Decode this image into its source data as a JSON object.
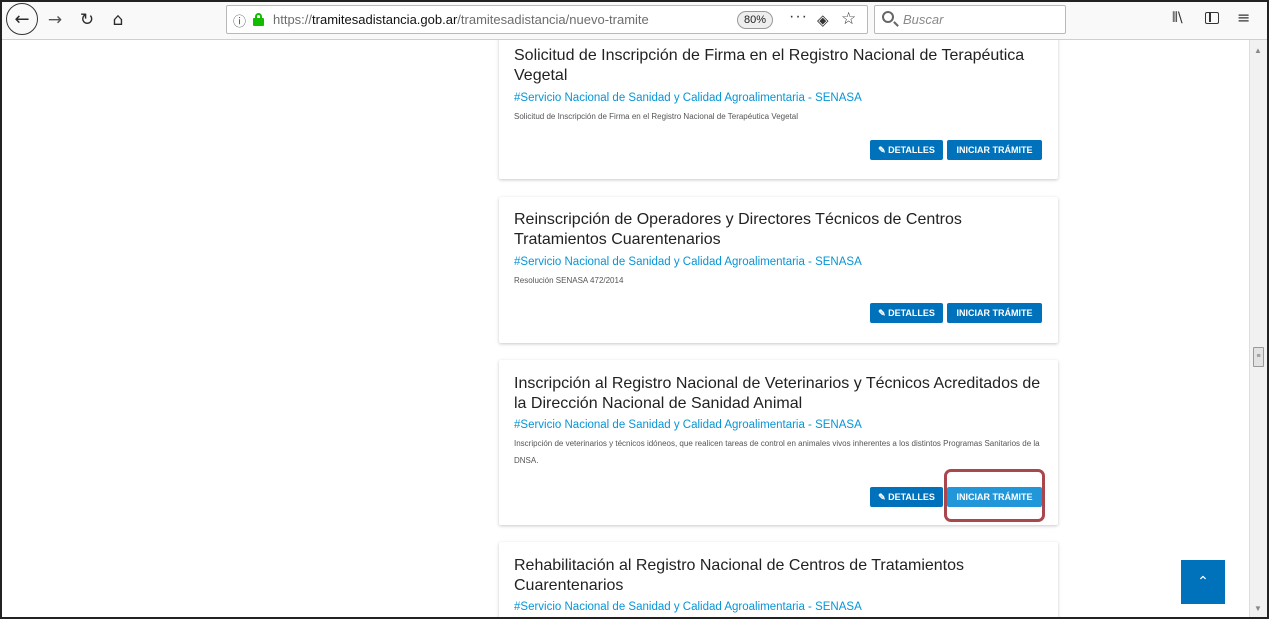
{
  "browser": {
    "url_prefix": "https://",
    "url_domain": "tramitesadistancia.gob.ar",
    "url_path": "/tramitesadistancia/nuevo-tramite",
    "zoom": "80%",
    "search_placeholder": "Buscar",
    "icons": [
      "back-arrow-icon",
      "forward-arrow-icon",
      "reload-icon",
      "home-icon",
      "info-icon",
      "lock-icon",
      "page-actions-icon",
      "pocket-icon",
      "bookmark-star-icon",
      "search-icon",
      "library-icon",
      "sidebar-icon",
      "hamburger-menu-icon"
    ]
  },
  "cards": [
    {
      "title": "Solicitud de Inscripción de Firma en el Registro Nacional de Terapéutica Vegetal",
      "org": "#Servicio Nacional de Sanidad y Calidad Agroalimentaria - SENASA",
      "desc": "Solicitud de Inscripción de Firma en el Registro Nacional de Terapéutica Vegetal",
      "details_label": "✎ DETALLES",
      "start_label": "INICIAR TRÁMITE"
    },
    {
      "title": "Reinscripción de Operadores y Directores Técnicos de Centros Tratamientos Cuarentenarios",
      "org": "#Servicio Nacional de Sanidad y Calidad Agroalimentaria - SENASA",
      "desc": "Resolución SENASA 472/2014",
      "details_label": "✎ DETALLES",
      "start_label": "INICIAR TRÁMITE"
    },
    {
      "title": "Inscripción al Registro Nacional de Veterinarios y Técnicos Acreditados de la Dirección Nacional de Sanidad Animal",
      "org": "#Servicio Nacional de Sanidad y Calidad Agroalimentaria - SENASA",
      "desc": "Inscripción de veterinarios y técnicos idóneos, que realicen tareas de control en animales vivos inherentes a los distintos Programas Sanitarios de la DNSA.",
      "details_label": "✎ DETALLES",
      "start_label": "INICIAR TRÁMITE"
    },
    {
      "title": "Rehabilitación al Registro Nacional de Centros de Tratamientos Cuarentenarios",
      "org": "#Servicio Nacional de Sanidad y Calidad Agroalimentaria - SENASA"
    }
  ],
  "back_to_top_label": "⌃",
  "colors": {
    "primary_button": "#0072bb",
    "org_link": "#0695d6",
    "highlight_box": "#a9474c"
  }
}
